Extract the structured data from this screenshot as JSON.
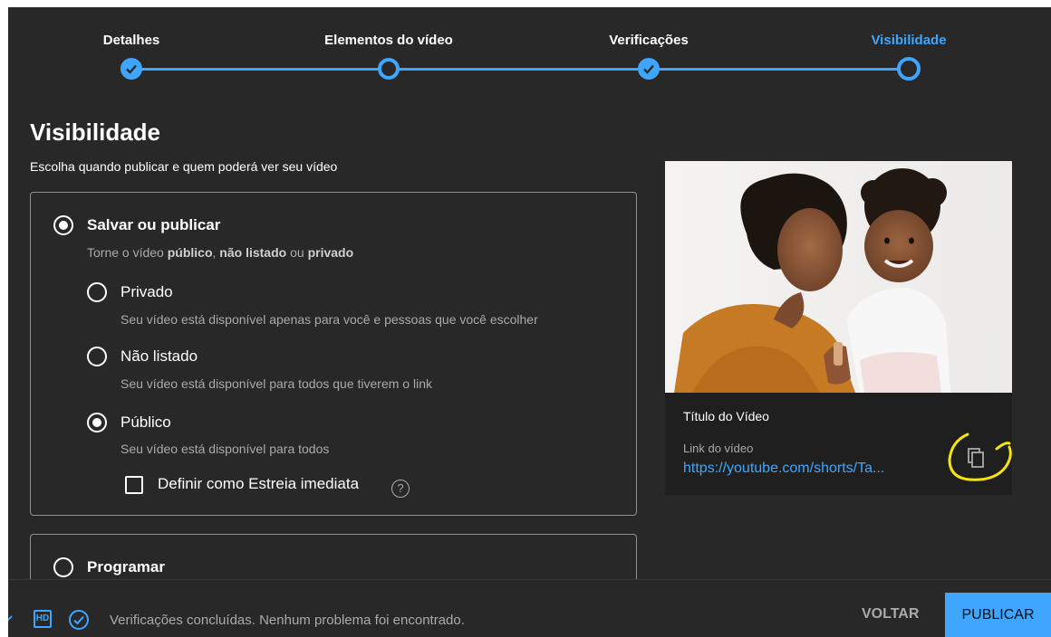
{
  "stepper": {
    "steps": [
      {
        "label": "Detalhes",
        "state": "done"
      },
      {
        "label": "Elementos do vídeo",
        "state": "open"
      },
      {
        "label": "Verificações",
        "state": "done"
      },
      {
        "label": "Visibilidade",
        "state": "active"
      }
    ]
  },
  "page": {
    "title": "Visibilidade",
    "subtitle": "Escolha quando publicar e quem poderá ver seu vídeo"
  },
  "save_publish": {
    "label": "Salvar ou publicar",
    "desc_prefix": "Torne o vídeo ",
    "desc_public": "público",
    "desc_sep": ", ",
    "desc_unlisted": "não listado",
    "desc_or": " ou ",
    "desc_private": "privado",
    "selected": true,
    "options": [
      {
        "label": "Privado",
        "desc": "Seu vídeo está disponível apenas para você e pessoas que você escolher",
        "selected": false
      },
      {
        "label": "Não listado",
        "desc": "Seu vídeo está disponível para todos que tiverem o link",
        "selected": false
      },
      {
        "label": "Público",
        "desc": "Seu vídeo está disponível para todos",
        "selected": true
      }
    ],
    "premiere_label": "Definir como Estreia imediata",
    "premiere_checked": false,
    "help_glyph": "?"
  },
  "schedule": {
    "label": "Programar",
    "selected": false
  },
  "preview": {
    "video_title": "Título do Vídeo",
    "link_label": "Link do vídeo",
    "link_url": "https://youtube.com/shorts/Ta...",
    "copy_icon": "copy-icon",
    "annotation_color": "#f5e50a"
  },
  "footer": {
    "hd_badge": "HD",
    "status": "Verificações concluídas. Nenhum problema foi encontrado.",
    "back_label": "VOLTAR",
    "publish_label": "PUBLICAR"
  },
  "colors": {
    "accent": "#3ea6ff",
    "background": "#282828",
    "card_border": "#909090"
  }
}
